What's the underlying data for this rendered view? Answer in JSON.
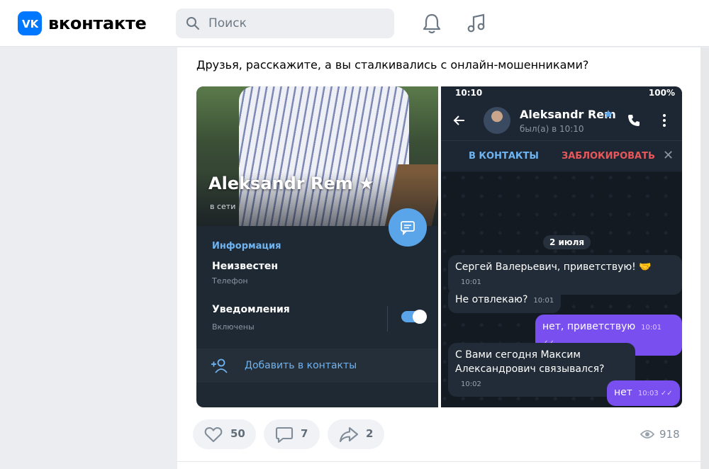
{
  "header": {
    "logo_text": "вконтакте",
    "search_placeholder": "Поиск"
  },
  "post": {
    "text": "Друзья, расскажите, а вы сталкивались с онлайн-мошенниками?",
    "likes": "50",
    "comments": "7",
    "shares": "2",
    "views": "918"
  },
  "left_screen": {
    "profile_name": "Aleksandr Rem ★",
    "profile_status": "в сети",
    "info_title": "Информация",
    "phone_value": "Неизвестен",
    "phone_label": "Телефон",
    "notifications_value": "Уведомления",
    "notifications_label": "Включены",
    "add_contact": "Добавить в контакты"
  },
  "right_screen": {
    "status_time": "10:10",
    "status_right": "100%",
    "chat_name": "Aleksandr Rem",
    "chat_status": "был(а) в 10:10",
    "action_contacts": "В КОНТАКТЫ",
    "action_block": "ЗАБЛОКИРОВАТЬ",
    "date": "2 июля",
    "messages": [
      {
        "text": "Сергей Валерьевич, приветствую! 🤝",
        "time": "10:01",
        "dir": "in"
      },
      {
        "text": "Не отвлекаю?",
        "time": "10:01",
        "dir": "in"
      },
      {
        "text": "нет, приветствую",
        "time": "10:01 ✓✓",
        "dir": "out"
      },
      {
        "text": "С Вами сегодня Максим Александрович связывался?",
        "time": "10:02",
        "dir": "in"
      },
      {
        "text": "нет",
        "time": "10:03 ✓✓",
        "dir": "out"
      }
    ]
  },
  "colors": {
    "brand": "#0077ff",
    "accent_blue": "#5aa5ea",
    "outgoing_bubble": "#7a4ff0",
    "block_red": "#e8575a"
  }
}
